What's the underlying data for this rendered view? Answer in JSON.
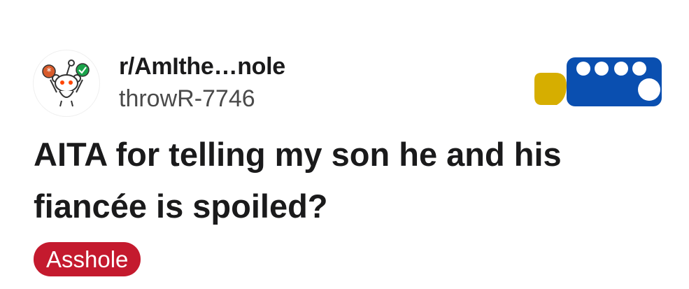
{
  "post": {
    "subreddit": "r/AmIthe…nole",
    "author": "throwR-7746",
    "title": "AITA for telling my son he and his fiancée is spoiled?",
    "flair": "Asshole"
  },
  "icons": {
    "avatar": "reddit-snoo-icon",
    "redaction": "redaction-overlay"
  },
  "colors": {
    "flair_bg": "#c41a2e",
    "censor_blue": "#0a4fb0",
    "censor_yellow": "#d6ae00",
    "text": "#1a1a1b",
    "muted": "#4a4a4a"
  }
}
